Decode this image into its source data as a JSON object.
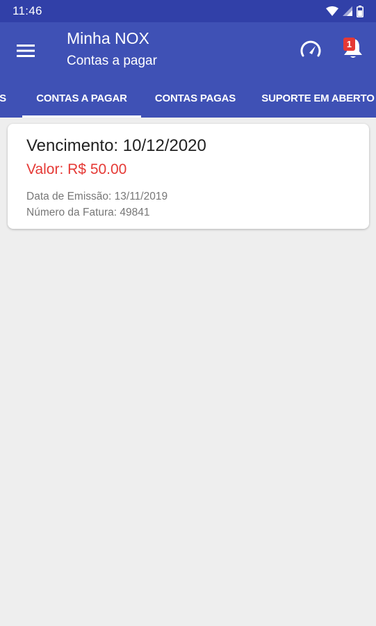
{
  "status_bar": {
    "time": "11:46"
  },
  "app_bar": {
    "title": "Minha NOX",
    "subtitle": "Contas a pagar",
    "notification_count": "1"
  },
  "tabs": [
    {
      "label": "S"
    },
    {
      "label": "CONTAS A PAGAR"
    },
    {
      "label": "CONTAS PAGAS"
    },
    {
      "label": "SUPORTE EM ABERTO"
    }
  ],
  "bills": [
    {
      "due": "Vencimento: 10/12/2020",
      "amount": "Valor: R$ 50.00",
      "issued": "Data de Emissão: 13/11/2019",
      "invoice": "Número da Fatura: 49841"
    }
  ],
  "colors": {
    "primary": "#3f51b5",
    "primary_dark": "#3140a8",
    "amount": "#e53935",
    "background": "#eeeeee"
  }
}
